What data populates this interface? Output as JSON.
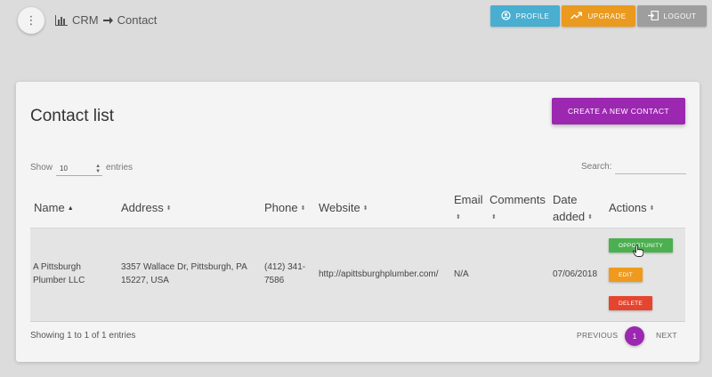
{
  "header": {
    "breadcrumb": {
      "root": "CRM",
      "current": "Contact"
    },
    "buttons": {
      "profile": "PROFILE",
      "upgrade": "UPGRADE",
      "logout": "LOGOUT"
    }
  },
  "card": {
    "title": "Contact list",
    "create_button": "CREATE A NEW CONTACT",
    "show_label": "Show",
    "entries_label": "entries",
    "page_size": "10",
    "search_label": "Search:",
    "search_value": ""
  },
  "table": {
    "columns": {
      "name": "Name",
      "address": "Address",
      "phone": "Phone",
      "website": "Website",
      "email": "Email",
      "comments": "Comments",
      "date_added": "Date added",
      "actions": "Actions"
    },
    "rows": [
      {
        "name": "A Pittsburgh Plumber LLC",
        "address": "3357 Wallace Dr, Pittsburgh, PA 15227, USA",
        "phone": "(412) 341-7586",
        "website": "http://apittsburghplumber.com/",
        "email": "N/A",
        "comments": "",
        "date_added": "07/06/2018",
        "actions": {
          "opportunity": "OPPORTUNITY",
          "edit": "EDIT",
          "delete": "DELETE"
        }
      }
    ]
  },
  "footer": {
    "info": "Showing 1 to 1 of 1 entries",
    "previous": "PREVIOUS",
    "current_page": "1",
    "next": "NEXT"
  },
  "colors": {
    "accent": "#9c27b0",
    "profile": "#4aaed0",
    "upgrade": "#ea9a1e",
    "logout": "#9e9e9e",
    "opportunity": "#4caf50",
    "edit": "#ef9a1c",
    "delete": "#e5452f"
  },
  "icons": {
    "menu": "more-vert-icon",
    "breadcrumb_root": "bar-chart-icon",
    "breadcrumb_separator": "arrow-right-icon",
    "profile": "user-circle-icon",
    "upgrade": "trending-up-icon",
    "logout": "logout-icon"
  }
}
